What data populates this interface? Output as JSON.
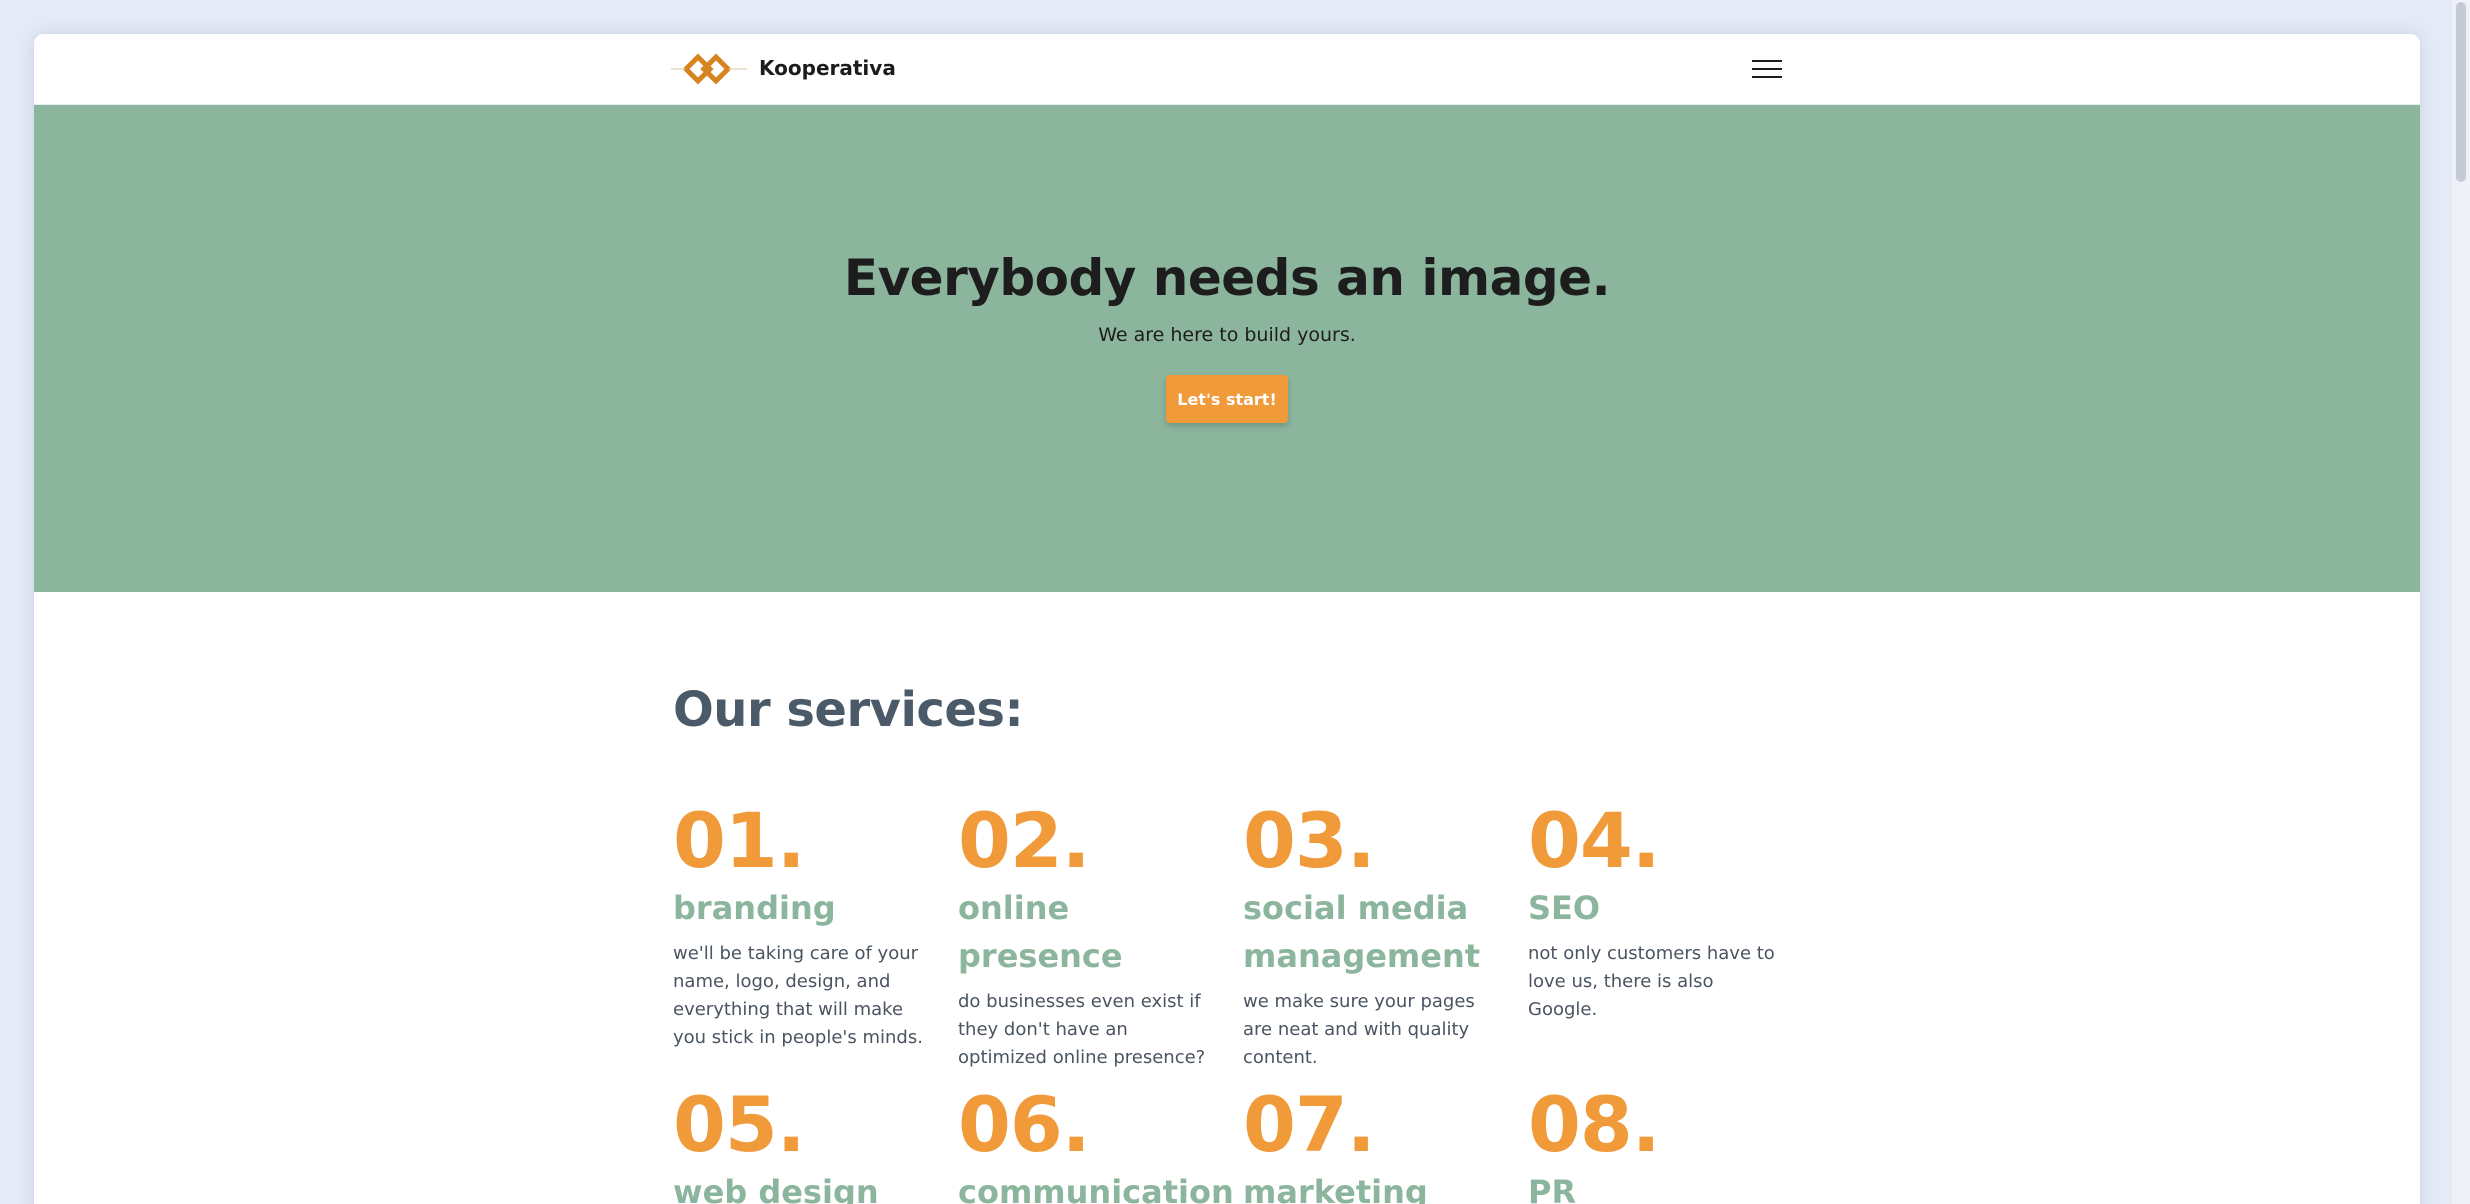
{
  "header": {
    "brand": "Kooperativa",
    "logo_icon": "diamond-chain-logo",
    "menu_icon": "hamburger-menu-icon"
  },
  "hero": {
    "title": "Everybody needs an image.",
    "subtitle": "We are here to build yours.",
    "cta_label": "Let's start!"
  },
  "services": {
    "title": "Our services:",
    "items": [
      {
        "num": "01.",
        "name": "branding",
        "desc": "we'll be taking care of your name, logo, design, and everything that will make you stick in people's minds."
      },
      {
        "num": "02.",
        "name": "online presence",
        "desc": "do businesses even exist if they don't have an optimized online presence?"
      },
      {
        "num": "03.",
        "name": "social media management",
        "desc": "we make sure your pages are neat and with quality content."
      },
      {
        "num": "04.",
        "name": "SEO",
        "desc": "not only customers have to love us, there is also Google."
      },
      {
        "num": "05.",
        "name": "web design",
        "desc": ""
      },
      {
        "num": "06.",
        "name": "communication",
        "desc": ""
      },
      {
        "num": "07.",
        "name": "marketing",
        "desc": ""
      },
      {
        "num": "08.",
        "name": "PR",
        "desc": ""
      }
    ]
  },
  "colors": {
    "accent": "#f09a3a",
    "hero_bg": "#8cb59d",
    "heading": "#4b5a68",
    "page_bg": "#e4eaf6"
  }
}
